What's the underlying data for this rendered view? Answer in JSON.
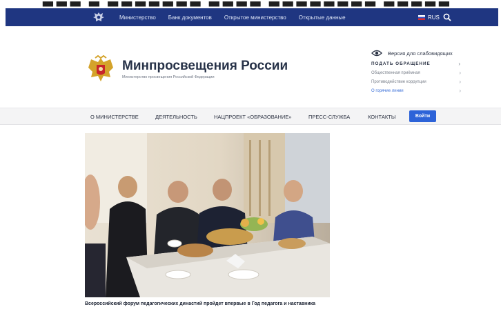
{
  "topbar": {
    "nav": [
      "Министерство",
      "Банк документов",
      "Открытое министерство",
      "Открытые данные"
    ],
    "lang": "RUS",
    "bg": "#1f3681"
  },
  "brand": {
    "title": "Минпросвещения России",
    "subtitle": "Министерство просвещения Российской Федерации"
  },
  "side": {
    "vision": "Версия для слабовидящих",
    "links": [
      {
        "label": "ПОДАТЬ ОБРАЩЕНИЕ",
        "style": "bold"
      },
      {
        "label": "Общественная приёмная",
        "style": "muted"
      },
      {
        "label": "Противодействие коррупции",
        "style": "muted"
      },
      {
        "label": "О горячие линии",
        "style": "link"
      }
    ]
  },
  "mainnav": {
    "items": [
      "О МИНИСТЕРСТВЕ",
      "ДЕЯТЕЛЬНОСТЬ",
      "НАЦПРОЕКТ «ОБРАЗОВАНИЕ»",
      "ПРЕСС-СЛУЖБА",
      "КОНТАКТЫ"
    ],
    "login": "Войти",
    "accent": "#2d63d8"
  },
  "news": {
    "caption": "Всероссийский форум педагогических династий пройдет впервые в Год педагога и наставника"
  }
}
